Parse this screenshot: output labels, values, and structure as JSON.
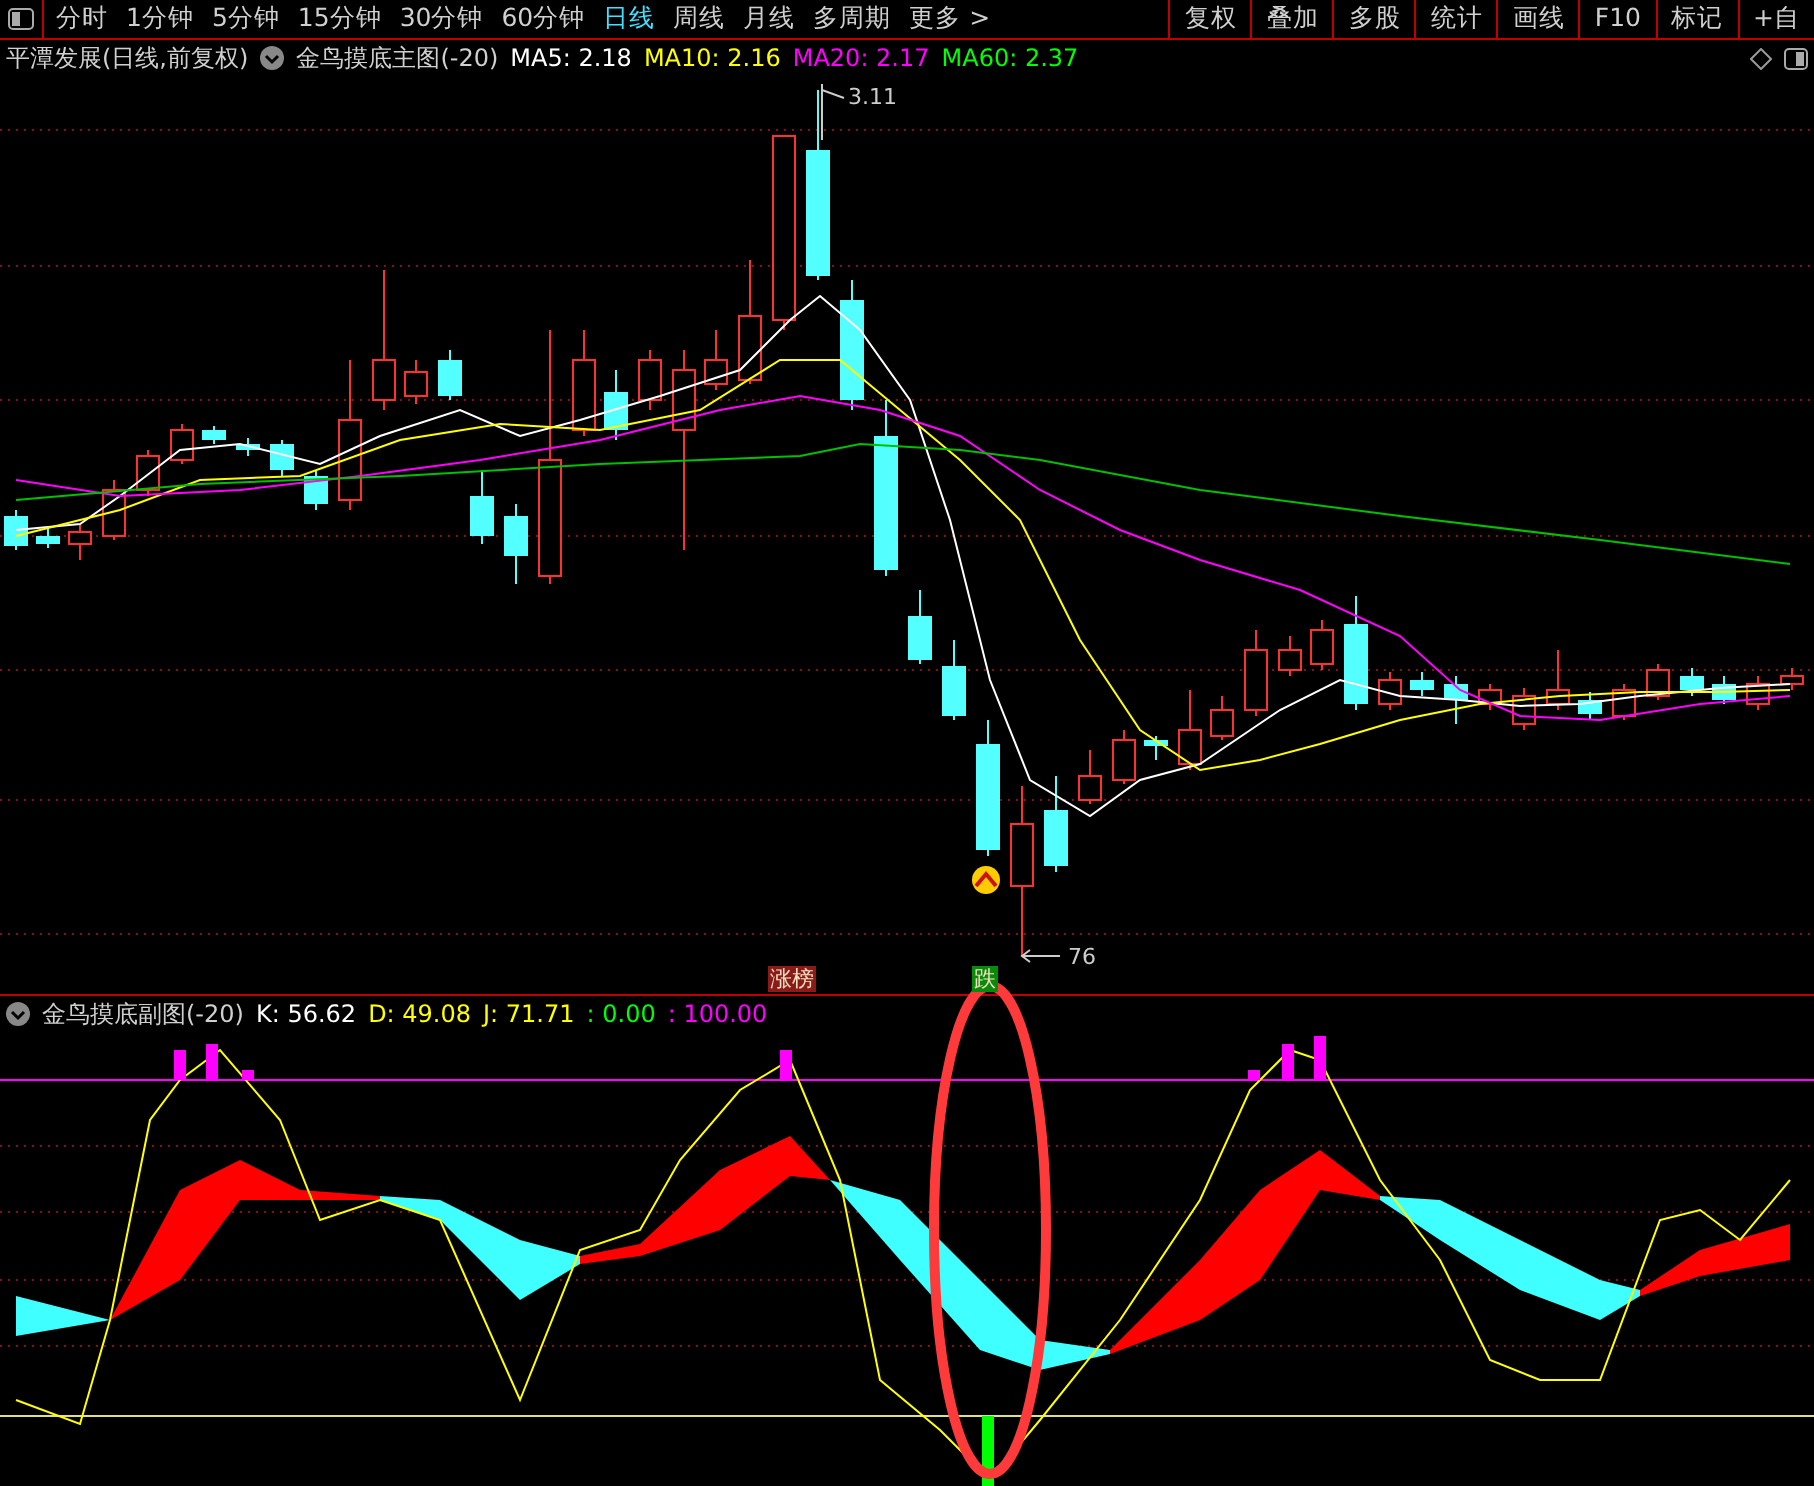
{
  "toolbar": {
    "periods": [
      {
        "label": "分时",
        "selected": false
      },
      {
        "label": "1分钟",
        "selected": false
      },
      {
        "label": "5分钟",
        "selected": false
      },
      {
        "label": "15分钟",
        "selected": false
      },
      {
        "label": "30分钟",
        "selected": false
      },
      {
        "label": "60分钟",
        "selected": false
      },
      {
        "label": "日线",
        "selected": true
      },
      {
        "label": "周线",
        "selected": false
      },
      {
        "label": "月线",
        "selected": false
      },
      {
        "label": "多周期",
        "selected": false
      },
      {
        "label": "更多 >",
        "selected": false
      }
    ],
    "buttons": [
      "复权",
      "叠加",
      "多股",
      "统计",
      "画线",
      "F10",
      "标记",
      "+自"
    ]
  },
  "main_chart": {
    "stock": "平潭发展(日线,前复权)",
    "indicator": "金鸟摸底主图(-20)",
    "values": [
      {
        "text": "MA5: 2.18",
        "color": "#ffffff"
      },
      {
        "text": "MA10: 2.16",
        "color": "#ffff00"
      },
      {
        "text": "MA20: 2.17",
        "color": "#ff00ff"
      },
      {
        "text": "MA60: 2.37",
        "color": "#00ff00"
      }
    ],
    "high_label": "3.11",
    "low_label": "76",
    "tags": [
      {
        "text": "涨榜",
        "color": "#8b1a1a"
      },
      {
        "text": "跌",
        "color": "#0a8a0a"
      }
    ]
  },
  "sub_chart": {
    "indicator": "金鸟摸底副图(-20)",
    "values": [
      {
        "text": "K: 56.62",
        "color": "#ffffff"
      },
      {
        "text": "D: 49.08",
        "color": "#ffff00"
      },
      {
        "text": "J: 71.71",
        "color": "#ffff00"
      },
      {
        "text": ": 0.00",
        "color": "#00ff00"
      },
      {
        "text": ": 100.00",
        "color": "#ff00ff"
      }
    ]
  }
}
